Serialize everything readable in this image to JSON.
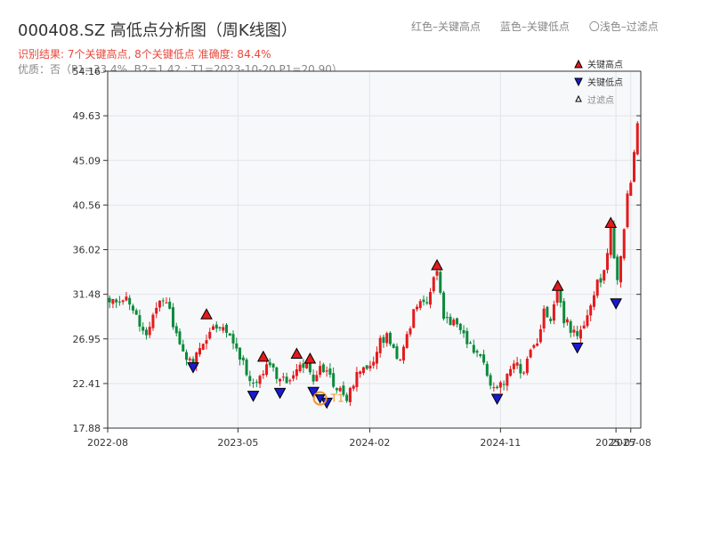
{
  "header": {
    "title": "000408.SZ 高低点分析图（周K线图）",
    "subtitle": "识别结果: 7个关键高点, 8个关键低点  准确度: 84.4%",
    "quality": "优质：否（P1=33.4%, B2=1.42 ; T1=2023-10-20 P1=20.90）",
    "legend_red": "红色–关键高点",
    "legend_blue": "蓝色–关键低点",
    "legend_light": "〇浅色–过滤点"
  },
  "colors": {
    "up": "#e31a1c",
    "down": "#0c8a3c",
    "high_marker": "#e31a1c",
    "low_marker": "#1a1ad1",
    "t1_ring": "#f0922b",
    "plot_bg": "#f7f8fa",
    "grid": "#e1e4ea"
  },
  "chart_data": {
    "type": "candlestick",
    "title": "000408.SZ 高低点分析图（周K线图）",
    "y_ticks": [
      "17.88",
      "22.41",
      "26.95",
      "31.48",
      "36.02",
      "40.56",
      "45.09",
      "49.63",
      "54.16"
    ],
    "ylim": [
      17.88,
      54.16
    ],
    "x_ticks": [
      "2022-08",
      "2023-05",
      "2024-02",
      "2024-11",
      "2025-07",
      "2025-08"
    ],
    "x_tick_dates": [
      "2022-08-01",
      "2023-05-01",
      "2024-02-01",
      "2024-11-01",
      "2025-07-01",
      "2025-08-01"
    ],
    "xlim": [
      "2022-08-01",
      "2025-08-22"
    ],
    "grid": true,
    "legend": {
      "position": "top-right",
      "entries": [
        "关键高点",
        "关键低点",
        "过滤点"
      ]
    },
    "price_path": [
      [
        "2022-08-05",
        31.2
      ],
      [
        "2022-08-26",
        30.8
      ],
      [
        "2022-09-09",
        31.6
      ],
      [
        "2022-09-23",
        30.0
      ],
      [
        "2022-10-07",
        28.0
      ],
      [
        "2022-10-21",
        26.8
      ],
      [
        "2022-11-04",
        29.5
      ],
      [
        "2022-11-18",
        31.0
      ],
      [
        "2022-12-02",
        30.6
      ],
      [
        "2022-12-16",
        28.5
      ],
      [
        "2022-12-30",
        26.5
      ],
      [
        "2023-01-13",
        25.2
      ],
      [
        "2023-01-27",
        24.7
      ],
      [
        "2023-02-10",
        26.0
      ],
      [
        "2023-02-24",
        27.2
      ],
      [
        "2023-03-10",
        28.6
      ],
      [
        "2023-03-24",
        28.0
      ],
      [
        "2023-04-07",
        27.9
      ],
      [
        "2023-04-21",
        26.9
      ],
      [
        "2023-05-05",
        25.0
      ],
      [
        "2023-05-19",
        23.8
      ],
      [
        "2023-06-02",
        22.2
      ],
      [
        "2023-06-16",
        23.4
      ],
      [
        "2023-06-30",
        24.2
      ],
      [
        "2023-07-14",
        23.5
      ],
      [
        "2023-07-28",
        22.9
      ],
      [
        "2023-08-11",
        23.0
      ],
      [
        "2023-08-25",
        23.4
      ],
      [
        "2023-09-08",
        24.6
      ],
      [
        "2023-09-22",
        24.0
      ],
      [
        "2023-10-06",
        22.5
      ],
      [
        "2023-10-13",
        23.8
      ],
      [
        "2023-10-20",
        24.4
      ],
      [
        "2023-11-03",
        23.4
      ],
      [
        "2023-11-17",
        22.6
      ],
      [
        "2023-12-01",
        21.8
      ],
      [
        "2023-12-15",
        21.0
      ],
      [
        "2023-12-29",
        22.6
      ],
      [
        "2024-01-12",
        24.0
      ],
      [
        "2024-01-26",
        23.8
      ],
      [
        "2024-02-09",
        24.6
      ],
      [
        "2024-02-23",
        26.5
      ],
      [
        "2024-03-08",
        27.0
      ],
      [
        "2024-03-22",
        25.5
      ],
      [
        "2024-04-05",
        24.5
      ],
      [
        "2024-04-19",
        27.0
      ],
      [
        "2024-05-03",
        29.5
      ],
      [
        "2024-05-17",
        31.0
      ],
      [
        "2024-05-31",
        30.5
      ],
      [
        "2024-06-14",
        33.5
      ],
      [
        "2024-06-21",
        33.8
      ],
      [
        "2024-07-05",
        29.5
      ],
      [
        "2024-07-19",
        28.2
      ],
      [
        "2024-08-02",
        28.8
      ],
      [
        "2024-08-16",
        27.0
      ],
      [
        "2024-08-30",
        26.0
      ],
      [
        "2024-09-13",
        25.0
      ],
      [
        "2024-09-27",
        24.5
      ],
      [
        "2024-10-11",
        22.5
      ],
      [
        "2024-10-25",
        22.0
      ],
      [
        "2024-11-08",
        22.3
      ],
      [
        "2024-11-22",
        23.8
      ],
      [
        "2024-12-06",
        24.2
      ],
      [
        "2024-12-20",
        23.5
      ],
      [
        "2025-01-03",
        25.5
      ],
      [
        "2025-01-17",
        26.5
      ],
      [
        "2025-01-31",
        29.5
      ],
      [
        "2025-02-14",
        29.0
      ],
      [
        "2025-02-28",
        31.5
      ],
      [
        "2025-03-14",
        29.0
      ],
      [
        "2025-03-28",
        28.0
      ],
      [
        "2025-04-11",
        27.2
      ],
      [
        "2025-04-25",
        28.5
      ],
      [
        "2025-05-09",
        30.5
      ],
      [
        "2025-05-23",
        32.5
      ],
      [
        "2025-06-06",
        33.5
      ],
      [
        "2025-06-20",
        38.0
      ],
      [
        "2025-06-27",
        35.5
      ],
      [
        "2025-07-04",
        33.0
      ],
      [
        "2025-07-11",
        35.5
      ],
      [
        "2025-07-18",
        38.0
      ],
      [
        "2025-07-25",
        41.5
      ],
      [
        "2025-08-01",
        43.0
      ],
      [
        "2025-08-08",
        46.0
      ],
      [
        "2025-08-15",
        49.0
      ],
      [
        "2025-08-21",
        51.5
      ]
    ],
    "key_highs": [
      {
        "date": "2023-02-24",
        "price": 28.8
      },
      {
        "date": "2023-06-23",
        "price": 24.5
      },
      {
        "date": "2023-09-01",
        "price": 24.8
      },
      {
        "date": "2023-09-29",
        "price": 24.3
      },
      {
        "date": "2024-06-21",
        "price": 33.8
      },
      {
        "date": "2025-03-01",
        "price": 31.7
      },
      {
        "date": "2025-06-20",
        "price": 38.1
      }
    ],
    "key_lows": [
      {
        "date": "2023-01-27",
        "price": 24.7
      },
      {
        "date": "2023-06-02",
        "price": 21.8
      },
      {
        "date": "2023-07-28",
        "price": 22.1
      },
      {
        "date": "2023-10-06",
        "price": 22.2
      },
      {
        "date": "2023-11-03",
        "price": 21.1
      },
      {
        "date": "2024-10-25",
        "price": 21.5
      },
      {
        "date": "2025-04-11",
        "price": 26.7
      },
      {
        "date": "2025-07-01",
        "price": 31.2
      }
    ],
    "t1": {
      "date": "2023-10-20",
      "price": 20.9,
      "label": "T1"
    }
  }
}
